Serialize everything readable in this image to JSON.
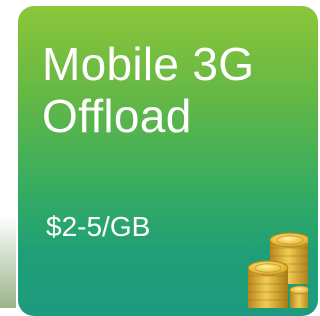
{
  "card": {
    "title_line1": "Mobile 3G",
    "title_line2": "Offload",
    "price": "$2-5/GB"
  },
  "icons": {
    "coins": "gold-coins-stack-icon"
  },
  "colors": {
    "card_top": "#8cc63a",
    "card_bottom": "#1d9a7f",
    "text": "#ffffff",
    "coin_gold": "#e2b93b"
  }
}
